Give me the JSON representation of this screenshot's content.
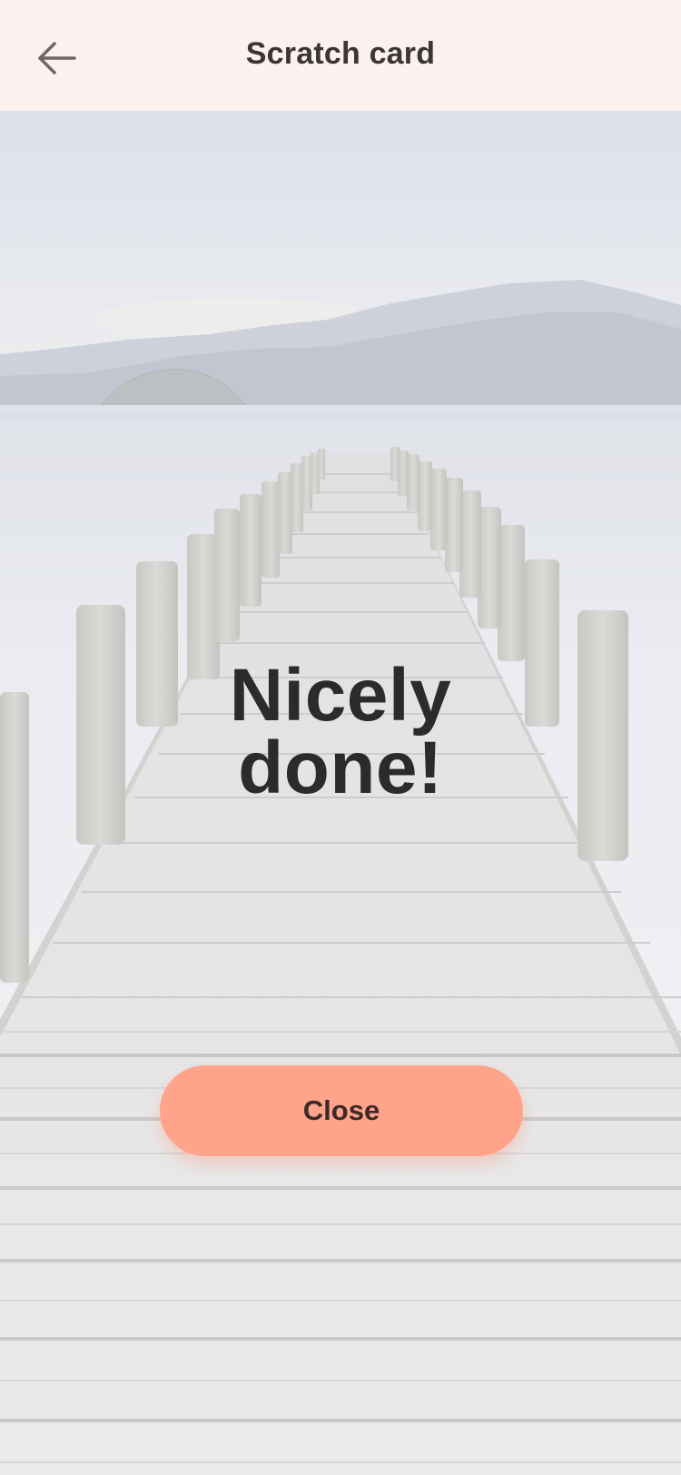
{
  "header": {
    "title": "Scratch card",
    "back_icon": "arrow-left-icon"
  },
  "result": {
    "line1": "Nicely",
    "line2": "done!"
  },
  "actions": {
    "close_label": "Close"
  },
  "colors": {
    "header_bg": "#fdf1ef",
    "button_bg": "#ffa38b",
    "text_dark": "#2b2b2c"
  }
}
